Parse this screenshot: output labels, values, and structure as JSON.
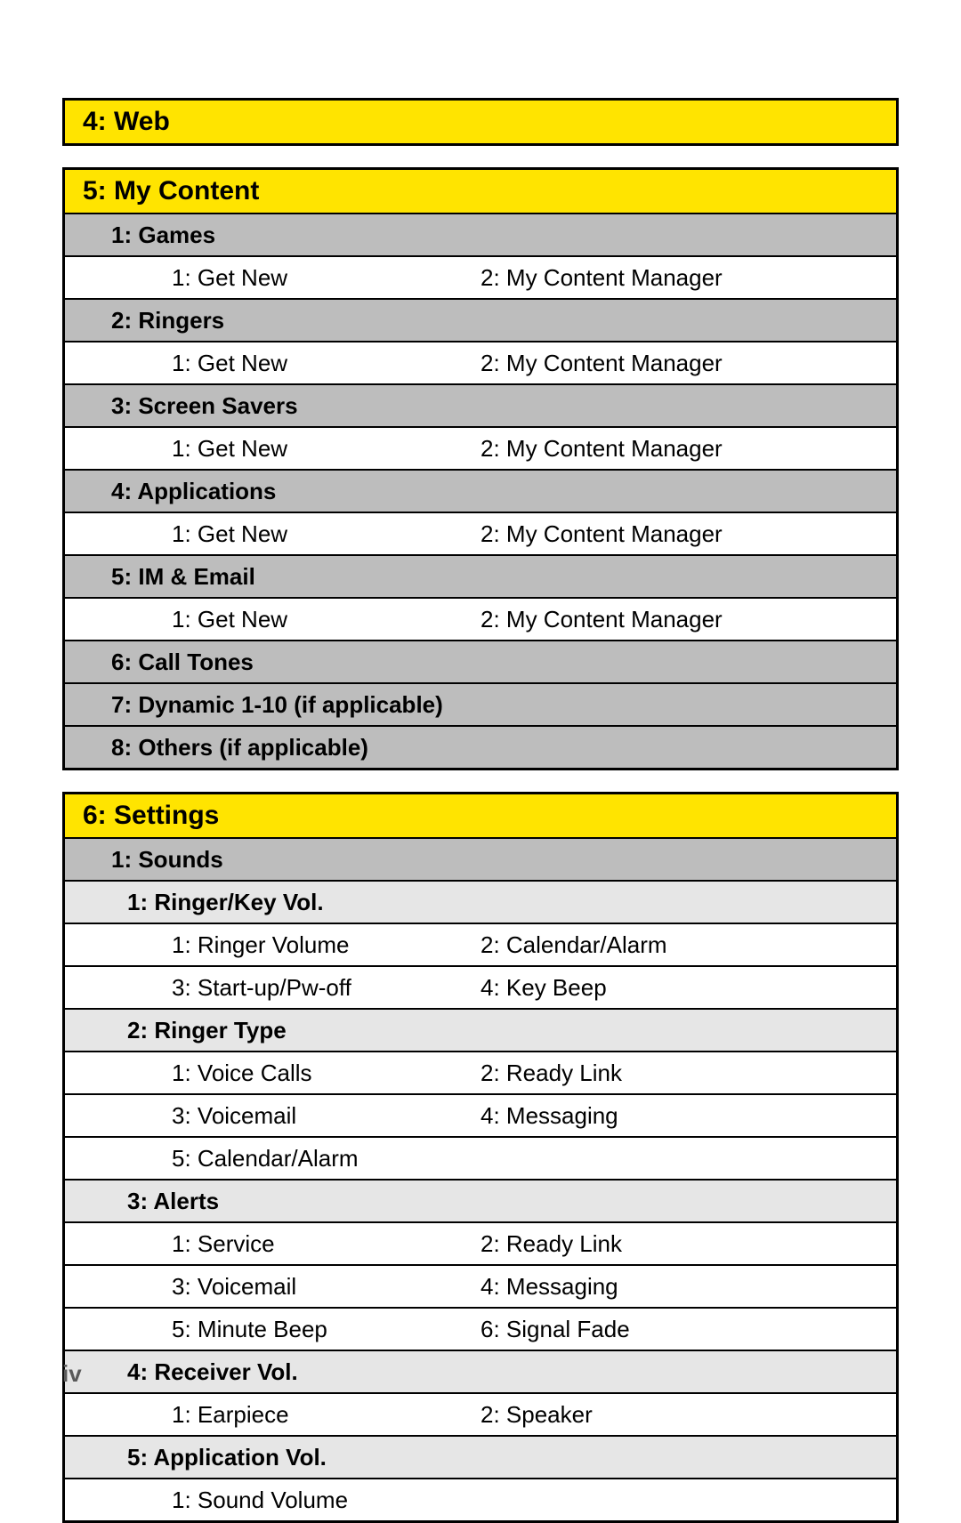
{
  "page_number": "iv",
  "sections": {
    "web": {
      "title": "4: Web"
    },
    "my_content": {
      "title": "5: My Content",
      "groups": [
        {
          "header": "1: Games",
          "items": [
            "1: Get New",
            "2: My Content Manager"
          ]
        },
        {
          "header": "2: Ringers",
          "items": [
            "1: Get New",
            "2: My Content Manager"
          ]
        },
        {
          "header": "3: Screen Savers",
          "items": [
            "1: Get New",
            "2: My Content Manager"
          ]
        },
        {
          "header": "4: Applications",
          "items": [
            "1: Get New",
            "2: My Content Manager"
          ]
        },
        {
          "header": "5: IM & Email",
          "items": [
            "1: Get New",
            "2: My Content Manager"
          ]
        },
        {
          "header": "6: Call Tones",
          "items": []
        },
        {
          "header": "7: Dynamic 1-10 (if applicable)",
          "items": []
        },
        {
          "header": "8: Others (if applicable)",
          "items": []
        }
      ]
    },
    "settings": {
      "title": "6: Settings",
      "sounds": {
        "header": "1: Sounds",
        "groups": [
          {
            "header": "1: Ringer/Key Vol.",
            "rows": [
              [
                "1: Ringer Volume",
                "2: Calendar/Alarm"
              ],
              [
                "3: Start-up/Pw-off",
                "4: Key Beep"
              ]
            ]
          },
          {
            "header": "2: Ringer Type",
            "rows": [
              [
                "1: Voice Calls",
                "2: Ready Link"
              ],
              [
                "3: Voicemail",
                "4: Messaging"
              ],
              [
                "5: Calendar/Alarm",
                ""
              ]
            ]
          },
          {
            "header": "3: Alerts",
            "rows": [
              [
                "1: Service",
                "2: Ready Link"
              ],
              [
                "3: Voicemail",
                "4: Messaging"
              ],
              [
                "5: Minute Beep",
                "6: Signal Fade"
              ]
            ]
          },
          {
            "header": "4: Receiver Vol.",
            "rows": [
              [
                "1: Earpiece",
                "2: Speaker"
              ]
            ]
          },
          {
            "header": "5: Application Vol.",
            "rows": [
              [
                "1: Sound Volume",
                ""
              ]
            ]
          }
        ]
      }
    }
  }
}
